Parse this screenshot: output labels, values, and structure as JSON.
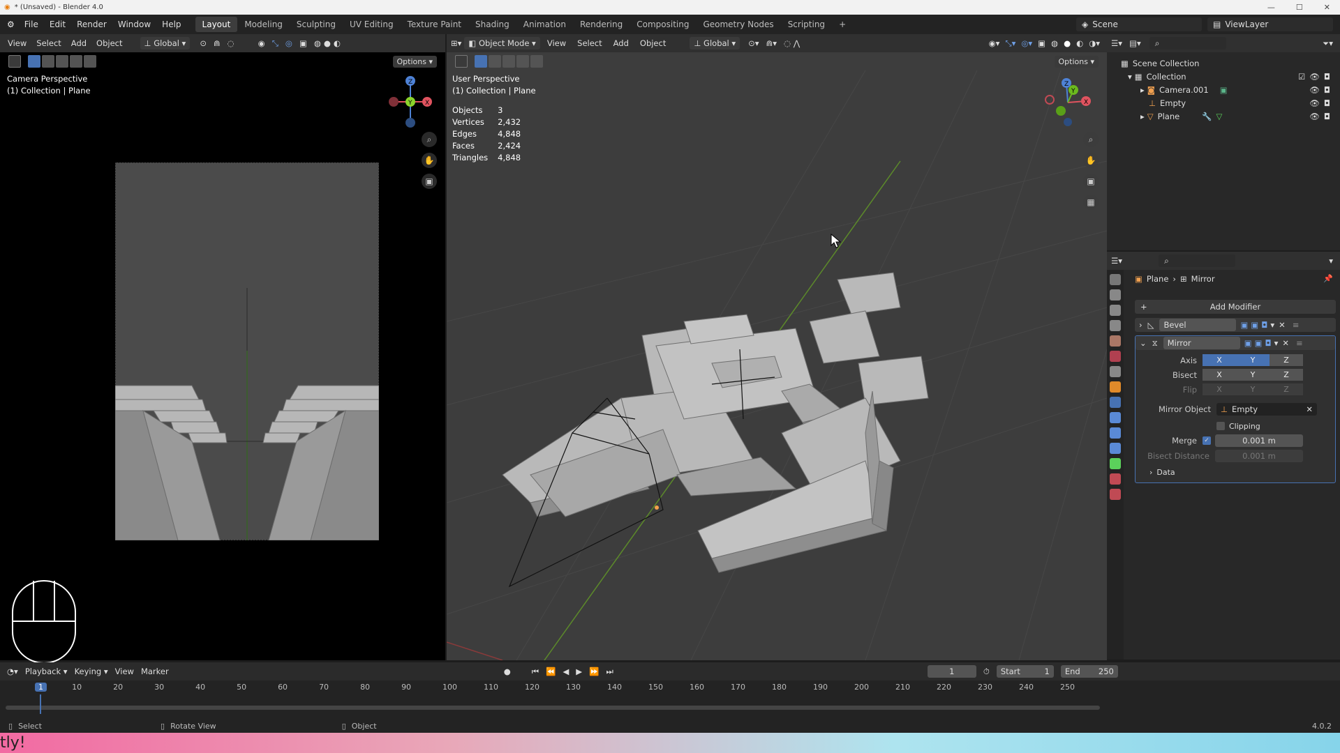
{
  "title": "* (Unsaved) - Blender 4.0",
  "menu": [
    "File",
    "Edit",
    "Render",
    "Window",
    "Help"
  ],
  "workspaces": [
    "Layout",
    "Modeling",
    "Sculpting",
    "UV Editing",
    "Texture Paint",
    "Shading",
    "Animation",
    "Rendering",
    "Compositing",
    "Geometry Nodes",
    "Scripting"
  ],
  "active_workspace": "Layout",
  "scene": "Scene",
  "view_layer": "ViewLayer",
  "left_view": {
    "menu": [
      "View",
      "Select",
      "Add",
      "Object"
    ],
    "transform": "Global",
    "options": "Options",
    "title": "Camera Perspective",
    "subtitle": "(1) Collection | Plane"
  },
  "main_view": {
    "mode": "Object Mode",
    "menu": [
      "View",
      "Select",
      "Add",
      "Object"
    ],
    "transform": "Global",
    "options": "Options",
    "title": "User Perspective",
    "subtitle": "(1) Collection | Plane",
    "stats": [
      {
        "k": "Objects",
        "v": "3"
      },
      {
        "k": "Vertices",
        "v": "2,432"
      },
      {
        "k": "Edges",
        "v": "4,848"
      },
      {
        "k": "Faces",
        "v": "2,424"
      },
      {
        "k": "Triangles",
        "v": "4,848"
      }
    ]
  },
  "outliner": {
    "root": "Scene Collection",
    "collection": "Collection",
    "items": [
      "Camera.001",
      "Empty",
      "Plane"
    ]
  },
  "properties": {
    "breadcrumb_obj": "Plane",
    "breadcrumb_mod": "Mirror",
    "add_modifier": "Add Modifier",
    "bevel": "Bevel",
    "mirror": "Mirror",
    "axis_label": "Axis",
    "bisect_label": "Bisect",
    "flip_label": "Flip",
    "axes": [
      "X",
      "Y",
      "Z"
    ],
    "mirror_object_label": "Mirror Object",
    "mirror_object": "Empty",
    "clipping": "Clipping",
    "merge_label": "Merge",
    "merge_value": "0.001 m",
    "bisect_distance_label": "Bisect Distance",
    "bisect_distance": "0.001 m",
    "data": "Data"
  },
  "timeline": {
    "menu": [
      "Playback",
      "Keying",
      "View",
      "Marker"
    ],
    "current_frame": "1",
    "start_label": "Start",
    "start": "1",
    "end_label": "End",
    "end": "250",
    "ticks": [
      "1",
      "10",
      "20",
      "30",
      "40",
      "50",
      "60",
      "70",
      "80",
      "90",
      "100",
      "110",
      "120",
      "130",
      "140",
      "150",
      "160",
      "170",
      "180",
      "190",
      "200",
      "210",
      "220",
      "230",
      "240",
      "250"
    ]
  },
  "status": {
    "select": "Select",
    "rotate": "Rotate View",
    "object": "Object",
    "version": "4.0.2"
  },
  "bottom_text": "tly!",
  "colors": {
    "accent": "#4772b3",
    "x_axis": "#e0535f",
    "y_axis": "#6bba1e",
    "z_axis": "#4e82d6"
  }
}
